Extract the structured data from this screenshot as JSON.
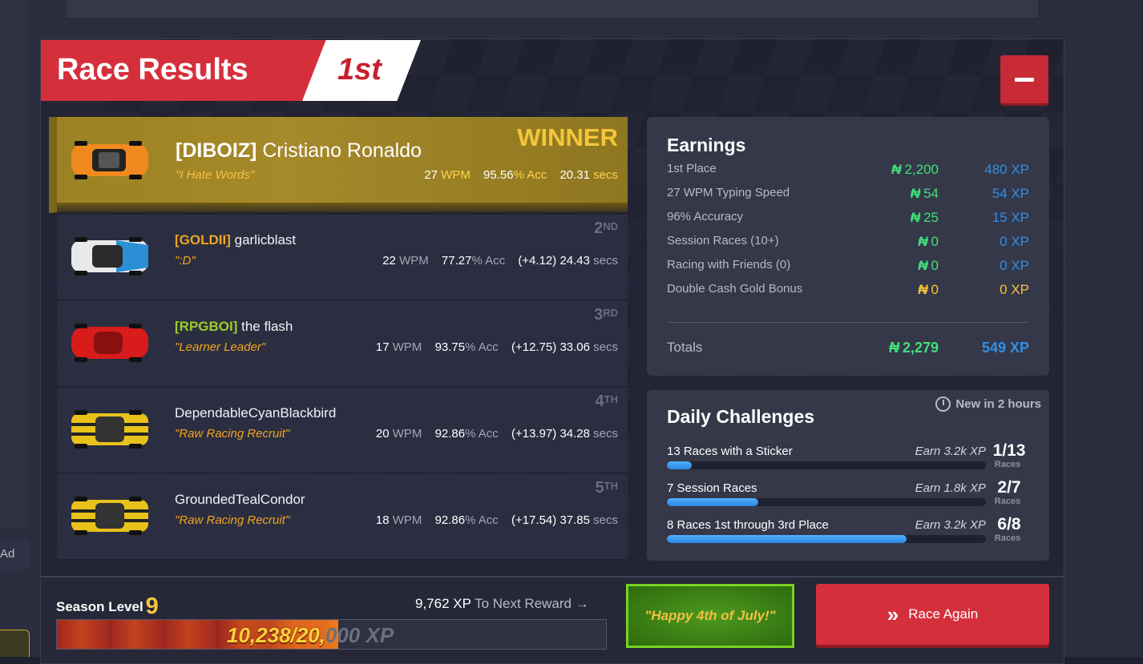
{
  "header": {
    "title": "Race Results",
    "place": "1st"
  },
  "racers": [
    {
      "tag": "[DIBOIZ]",
      "name": "Cristiano Ronaldo",
      "title": "\"I Hate Words\"",
      "wpm": "27",
      "acc": "95.56",
      "delta": "",
      "secs": "20.31",
      "place_num": "",
      "place_sfx": "",
      "winner_label": "WINNER",
      "car_color": "#f08a1e",
      "tag_color": "#ffffff"
    },
    {
      "tag": "[GOLDII]",
      "name": "garlicblast",
      "title": "\":D\"",
      "wpm": "22",
      "acc": "77.27",
      "delta": "(+4.12)",
      "secs": "24.43",
      "place_num": "2",
      "place_sfx": "ND",
      "car_color": "#2b8fd6",
      "tag_color": "#f0a422"
    },
    {
      "tag": "[RPGBOI]",
      "name": "the flash",
      "title": "\"Learner Leader\"",
      "wpm": "17",
      "acc": "93.75",
      "delta": "(+12.75)",
      "secs": "33.06",
      "place_num": "3",
      "place_sfx": "RD",
      "car_color": "#d81c1c",
      "tag_color": "#9ccc2b"
    },
    {
      "tag": "",
      "name": "DependableCyanBlackbird",
      "title": "\"Raw Racing Recruit\"",
      "wpm": "20",
      "acc": "92.86",
      "delta": "(+13.97)",
      "secs": "34.28",
      "place_num": "4",
      "place_sfx": "TH",
      "car_color": "#e8c21a",
      "tag_color": "#ffffff"
    },
    {
      "tag": "",
      "name": "GroundedTealCondor",
      "title": "\"Raw Racing Recruit\"",
      "wpm": "18",
      "acc": "92.86",
      "delta": "(+17.54)",
      "secs": "37.85",
      "place_num": "5",
      "place_sfx": "TH",
      "car_color": "#e8c21a",
      "tag_color": "#ffffff"
    }
  ],
  "units": {
    "wpm": "WPM",
    "acc": "% Acc",
    "secs": "secs"
  },
  "earnings": {
    "title": "Earnings",
    "currency_symbol": "₦",
    "rows": [
      {
        "label": "1st Place",
        "cash": "2,200",
        "xp": "480 XP",
        "cash_color": "#3fe07a",
        "xp_color": "#2f8fe6"
      },
      {
        "label": "27 WPM Typing Speed",
        "cash": "54",
        "xp": "54 XP",
        "cash_color": "#3fe07a",
        "xp_color": "#2f8fe6"
      },
      {
        "label": "96% Accuracy",
        "cash": "25",
        "xp": "15 XP",
        "cash_color": "#3fe07a",
        "xp_color": "#2f8fe6"
      },
      {
        "label": "Session Races (10+)",
        "cash": "0",
        "xp": "0 XP",
        "cash_color": "#3fe07a",
        "xp_color": "#2f8fe6"
      },
      {
        "label": "Racing with Friends (0)",
        "cash": "0",
        "xp": "0 XP",
        "cash_color": "#3fe07a",
        "xp_color": "#2f8fe6"
      },
      {
        "label": "Double Cash Gold Bonus",
        "cash": "0",
        "xp": "0 XP",
        "cash_color": "#f6c53a",
        "xp_color": "#f6c53a"
      }
    ],
    "totals": {
      "label": "Totals",
      "cash": "2,279",
      "xp": "549 XP"
    }
  },
  "daily": {
    "title": "Daily Challenges",
    "refresh": "New in 2 hours",
    "items": [
      {
        "label": "13 Races with a Sticker",
        "earn": "Earn 3.2k XP",
        "count": "1/13",
        "unit": "Races",
        "progress": 0.077
      },
      {
        "label": "7 Session Races",
        "earn": "Earn 1.8k XP",
        "count": "2/7",
        "unit": "Races",
        "progress": 0.286
      },
      {
        "label": "8 Races 1st through 3rd Place",
        "earn": "Earn 3.2k XP",
        "count": "6/8",
        "unit": "Races",
        "progress": 0.75
      }
    ]
  },
  "season": {
    "label": "Season Level",
    "level": "9",
    "to_next_value": "9,762 XP",
    "to_next_label": "To Next Reward →",
    "xp_current": "10,238/20,",
    "xp_rest": "000 XP",
    "progress": 0.512
  },
  "greeting": "\"Happy 4th of July!\"",
  "race_again": {
    "icon": "»",
    "label": "Race Again"
  },
  "side": {
    "ad_label": "Ad"
  },
  "colors": {
    "accent_red": "#d62f3c",
    "gold": "#f6c53a",
    "cash_green": "#3fe07a",
    "xp_blue": "#2f8fe6"
  }
}
